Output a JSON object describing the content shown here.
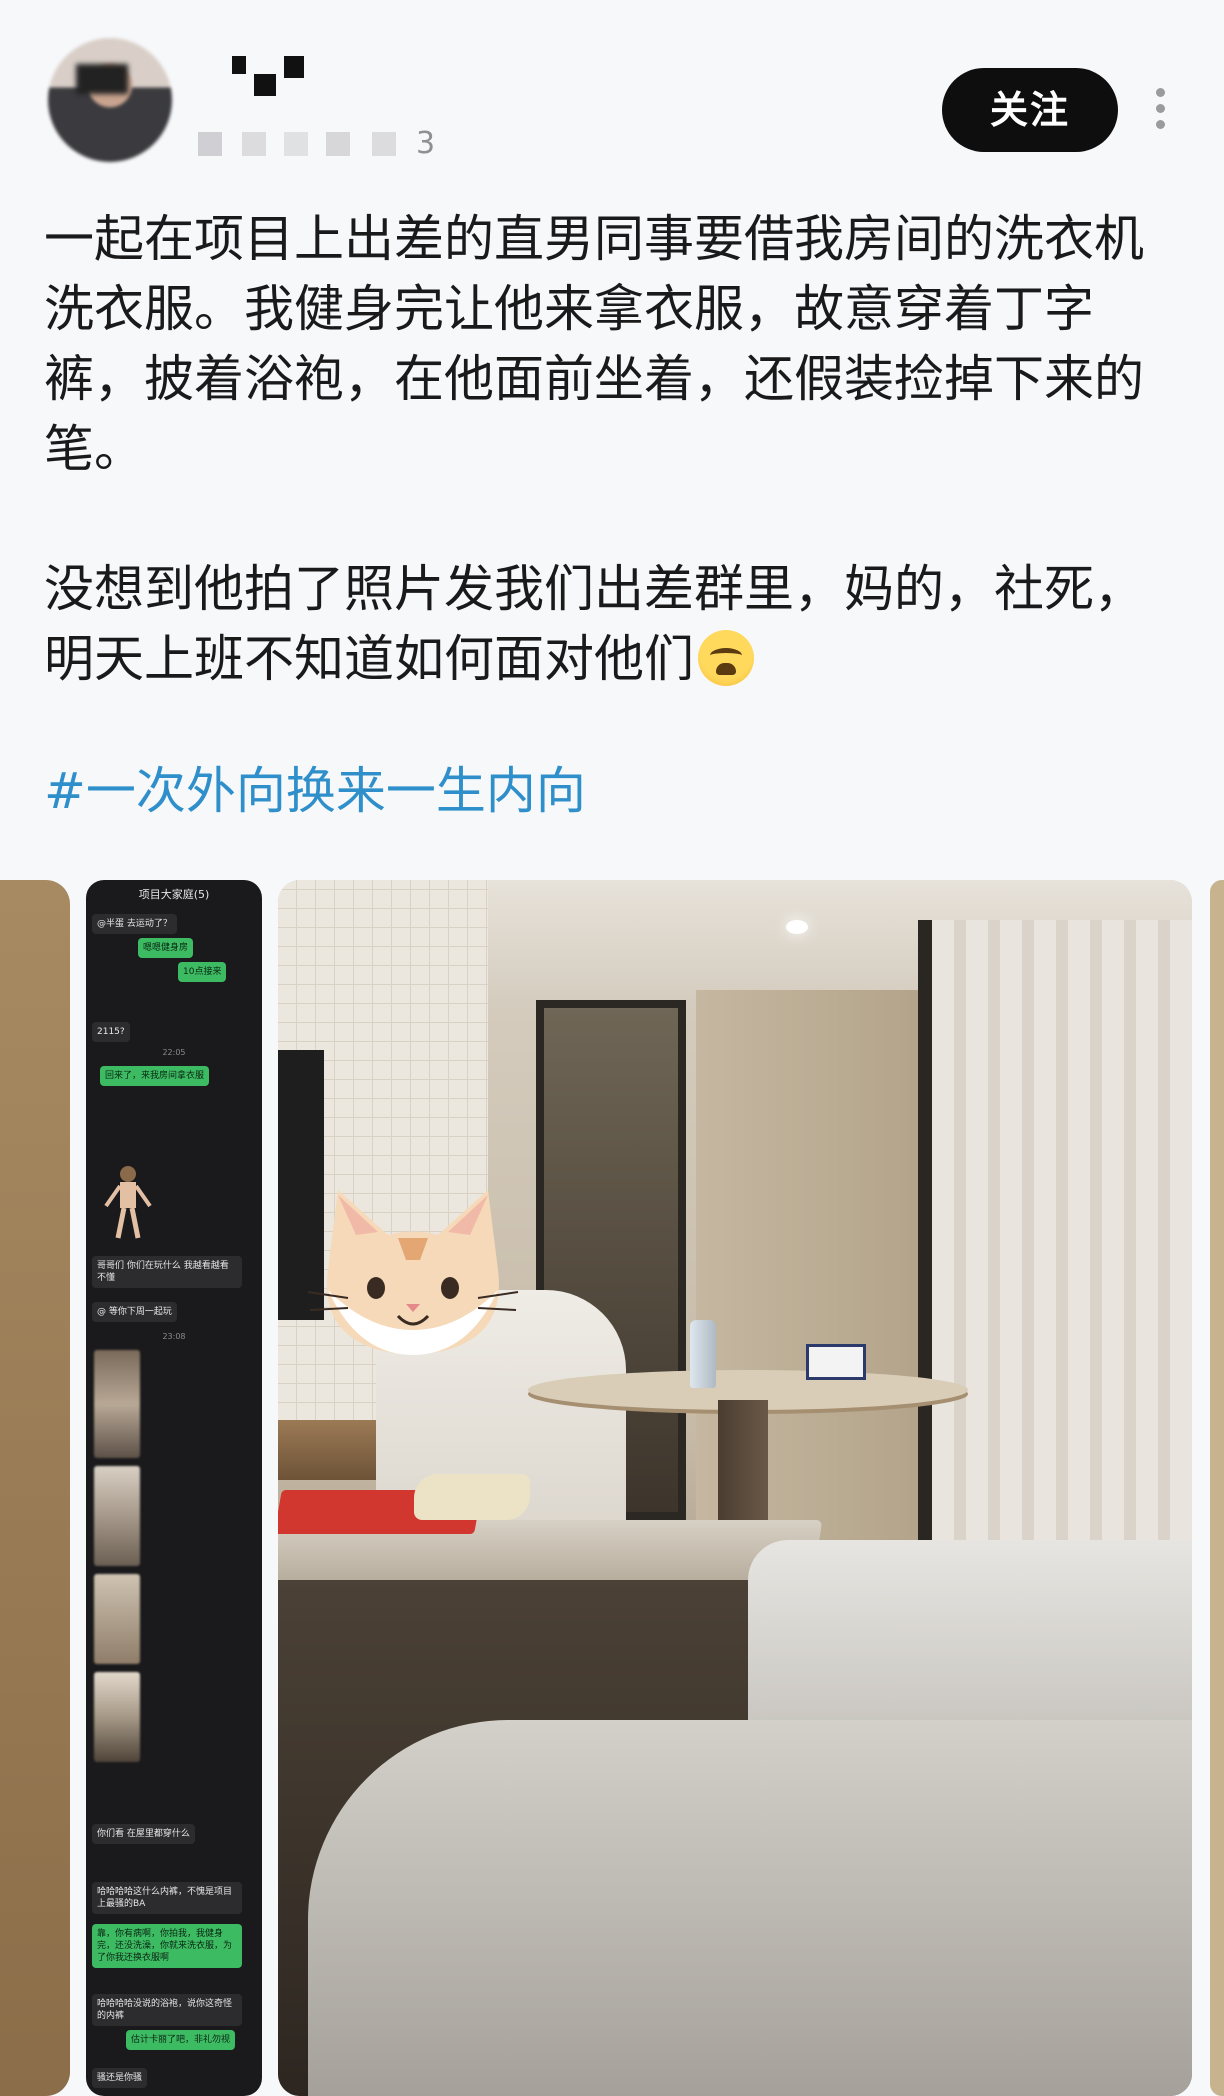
{
  "header": {
    "follow_label": "关注",
    "meta_tail": "3"
  },
  "post": {
    "paragraph1": "一起在项目上出差的直男同事要借我房间的洗衣机洗衣服。我健身完让他来拿衣服，故意穿着丁字裤，披着浴袍，在他面前坐着，还假装捡掉下来的笔。",
    "paragraph2": "没想到他拍了照片发我们出差群里，妈的，社死，明天上班不知道如何面对他们",
    "hashtag": "#一次外向换来一生内向"
  },
  "chat": {
    "title": "项目大家庭(5)",
    "messages": [
      {
        "text": "@半蛋 去运动了？",
        "me": false
      },
      {
        "text": "嗯嗯健身房",
        "me": true
      },
      {
        "text": "10点接来",
        "me": true
      },
      {
        "text": "2115?",
        "me": false
      },
      {
        "text": "22:05",
        "time": true
      },
      {
        "text": "回来了，来我房间拿衣服",
        "me": true
      },
      {
        "text": "哥哥们 你们在玩什么 我越看越看不懂",
        "me": false
      },
      {
        "text": "@ 等你下周一起玩",
        "me": false
      },
      {
        "text": "23:08",
        "time": true
      },
      {
        "text": "你们看 在屋里都穿什么",
        "me": false
      },
      {
        "text": "哈哈哈哈这什么内裤，不愧是项目上最骚的BA",
        "me": false
      },
      {
        "text": "靠，你有病啊，你拍我，我健身完，还没洗澡，你就来洗衣服，为了你我还换衣服啊",
        "me": true
      },
      {
        "text": "哈哈哈哈没说的浴袍，说你这奇怪的内裤",
        "me": false
      },
      {
        "text": "估计卡丽了吧，非礼勿视",
        "me": true
      },
      {
        "text": "骚还是你骚",
        "me": false
      }
    ]
  },
  "colors": {
    "hashtag": "#2f8fcb",
    "follow_bg": "#0e0e0e",
    "chat_me_bubble": "#3dbb63"
  },
  "icons": {
    "more": "vertical-ellipsis-icon",
    "emoji": "tired-face-emoji"
  }
}
